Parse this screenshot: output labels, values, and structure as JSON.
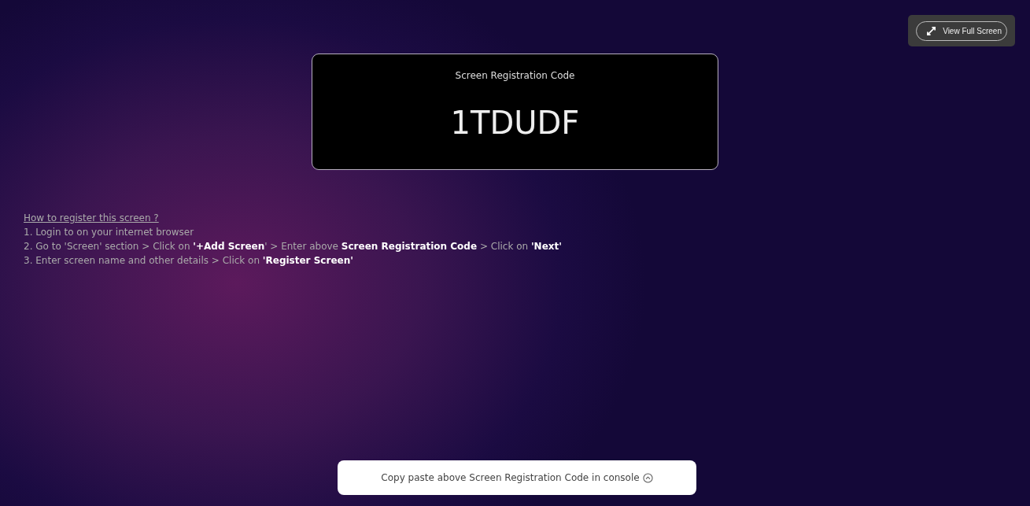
{
  "fullscreen_button": {
    "label": "View Full Screen"
  },
  "code_card": {
    "title": "Screen Registration Code",
    "code": "1TDUDF"
  },
  "instructions": {
    "heading": "How to register this screen ?",
    "steps": [
      "1. Login to on your internet browser",
      "2. Go to 'Screen' section > Click on **'+Add Screen**' > Enter above **Screen Registration Code** > Click on **'Next'**",
      "3. Enter screen name and other details > Click on **'Register Screen'**"
    ]
  },
  "toast": {
    "text": "Copy paste above Screen Registration Code in console"
  }
}
